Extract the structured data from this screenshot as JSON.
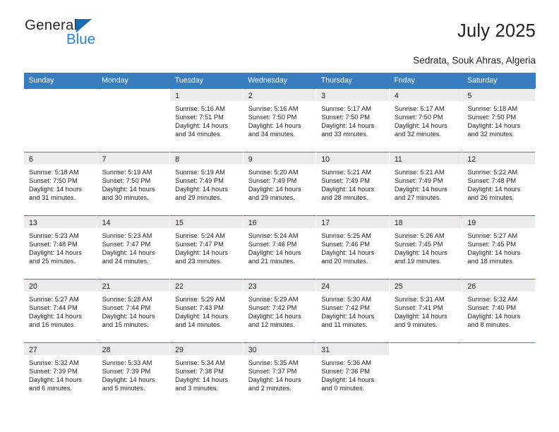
{
  "brand": {
    "name_part1": "General",
    "name_part2": "Blue",
    "accent_color": "#2585d3",
    "triangle_color": "#176cb5"
  },
  "header": {
    "title": "July 2025",
    "subtitle": "Sedrata, Souk Ahras, Algeria"
  },
  "calendar": {
    "header_bg": "#3a7cc0",
    "daynum_bg": "#ebebeb",
    "weekdays": [
      "Sunday",
      "Monday",
      "Tuesday",
      "Wednesday",
      "Thursday",
      "Friday",
      "Saturday"
    ],
    "weeks": [
      [
        {
          "day": "",
          "sunrise": "",
          "sunset": "",
          "daylight_line1": "",
          "daylight_line2": "",
          "empty": true
        },
        {
          "day": "",
          "sunrise": "",
          "sunset": "",
          "daylight_line1": "",
          "daylight_line2": "",
          "empty": true
        },
        {
          "day": "1",
          "sunrise": "Sunrise: 5:16 AM",
          "sunset": "Sunset: 7:51 PM",
          "daylight_line1": "Daylight: 14 hours",
          "daylight_line2": "and 34 minutes.",
          "empty": false
        },
        {
          "day": "2",
          "sunrise": "Sunrise: 5:16 AM",
          "sunset": "Sunset: 7:50 PM",
          "daylight_line1": "Daylight: 14 hours",
          "daylight_line2": "and 34 minutes.",
          "empty": false
        },
        {
          "day": "3",
          "sunrise": "Sunrise: 5:17 AM",
          "sunset": "Sunset: 7:50 PM",
          "daylight_line1": "Daylight: 14 hours",
          "daylight_line2": "and 33 minutes.",
          "empty": false
        },
        {
          "day": "4",
          "sunrise": "Sunrise: 5:17 AM",
          "sunset": "Sunset: 7:50 PM",
          "daylight_line1": "Daylight: 14 hours",
          "daylight_line2": "and 32 minutes.",
          "empty": false
        },
        {
          "day": "5",
          "sunrise": "Sunrise: 5:18 AM",
          "sunset": "Sunset: 7:50 PM",
          "daylight_line1": "Daylight: 14 hours",
          "daylight_line2": "and 32 minutes.",
          "empty": false
        }
      ],
      [
        {
          "day": "6",
          "sunrise": "Sunrise: 5:18 AM",
          "sunset": "Sunset: 7:50 PM",
          "daylight_line1": "Daylight: 14 hours",
          "daylight_line2": "and 31 minutes.",
          "empty": false
        },
        {
          "day": "7",
          "sunrise": "Sunrise: 5:19 AM",
          "sunset": "Sunset: 7:50 PM",
          "daylight_line1": "Daylight: 14 hours",
          "daylight_line2": "and 30 minutes.",
          "empty": false
        },
        {
          "day": "8",
          "sunrise": "Sunrise: 5:19 AM",
          "sunset": "Sunset: 7:49 PM",
          "daylight_line1": "Daylight: 14 hours",
          "daylight_line2": "and 29 minutes.",
          "empty": false
        },
        {
          "day": "9",
          "sunrise": "Sunrise: 5:20 AM",
          "sunset": "Sunset: 7:49 PM",
          "daylight_line1": "Daylight: 14 hours",
          "daylight_line2": "and 29 minutes.",
          "empty": false
        },
        {
          "day": "10",
          "sunrise": "Sunrise: 5:21 AM",
          "sunset": "Sunset: 7:49 PM",
          "daylight_line1": "Daylight: 14 hours",
          "daylight_line2": "and 28 minutes.",
          "empty": false
        },
        {
          "day": "11",
          "sunrise": "Sunrise: 5:21 AM",
          "sunset": "Sunset: 7:49 PM",
          "daylight_line1": "Daylight: 14 hours",
          "daylight_line2": "and 27 minutes.",
          "empty": false
        },
        {
          "day": "12",
          "sunrise": "Sunrise: 5:22 AM",
          "sunset": "Sunset: 7:48 PM",
          "daylight_line1": "Daylight: 14 hours",
          "daylight_line2": "and 26 minutes.",
          "empty": false
        }
      ],
      [
        {
          "day": "13",
          "sunrise": "Sunrise: 5:23 AM",
          "sunset": "Sunset: 7:48 PM",
          "daylight_line1": "Daylight: 14 hours",
          "daylight_line2": "and 25 minutes.",
          "empty": false
        },
        {
          "day": "14",
          "sunrise": "Sunrise: 5:23 AM",
          "sunset": "Sunset: 7:47 PM",
          "daylight_line1": "Daylight: 14 hours",
          "daylight_line2": "and 24 minutes.",
          "empty": false
        },
        {
          "day": "15",
          "sunrise": "Sunrise: 5:24 AM",
          "sunset": "Sunset: 7:47 PM",
          "daylight_line1": "Daylight: 14 hours",
          "daylight_line2": "and 23 minutes.",
          "empty": false
        },
        {
          "day": "16",
          "sunrise": "Sunrise: 5:24 AM",
          "sunset": "Sunset: 7:46 PM",
          "daylight_line1": "Daylight: 14 hours",
          "daylight_line2": "and 21 minutes.",
          "empty": false
        },
        {
          "day": "17",
          "sunrise": "Sunrise: 5:25 AM",
          "sunset": "Sunset: 7:46 PM",
          "daylight_line1": "Daylight: 14 hours",
          "daylight_line2": "and 20 minutes.",
          "empty": false
        },
        {
          "day": "18",
          "sunrise": "Sunrise: 5:26 AM",
          "sunset": "Sunset: 7:45 PM",
          "daylight_line1": "Daylight: 14 hours",
          "daylight_line2": "and 19 minutes.",
          "empty": false
        },
        {
          "day": "19",
          "sunrise": "Sunrise: 5:27 AM",
          "sunset": "Sunset: 7:45 PM",
          "daylight_line1": "Daylight: 14 hours",
          "daylight_line2": "and 18 minutes.",
          "empty": false
        }
      ],
      [
        {
          "day": "20",
          "sunrise": "Sunrise: 5:27 AM",
          "sunset": "Sunset: 7:44 PM",
          "daylight_line1": "Daylight: 14 hours",
          "daylight_line2": "and 16 minutes.",
          "empty": false
        },
        {
          "day": "21",
          "sunrise": "Sunrise: 5:28 AM",
          "sunset": "Sunset: 7:44 PM",
          "daylight_line1": "Daylight: 14 hours",
          "daylight_line2": "and 15 minutes.",
          "empty": false
        },
        {
          "day": "22",
          "sunrise": "Sunrise: 5:29 AM",
          "sunset": "Sunset: 7:43 PM",
          "daylight_line1": "Daylight: 14 hours",
          "daylight_line2": "and 14 minutes.",
          "empty": false
        },
        {
          "day": "23",
          "sunrise": "Sunrise: 5:29 AM",
          "sunset": "Sunset: 7:42 PM",
          "daylight_line1": "Daylight: 14 hours",
          "daylight_line2": "and 12 minutes.",
          "empty": false
        },
        {
          "day": "24",
          "sunrise": "Sunrise: 5:30 AM",
          "sunset": "Sunset: 7:42 PM",
          "daylight_line1": "Daylight: 14 hours",
          "daylight_line2": "and 11 minutes.",
          "empty": false
        },
        {
          "day": "25",
          "sunrise": "Sunrise: 5:31 AM",
          "sunset": "Sunset: 7:41 PM",
          "daylight_line1": "Daylight: 14 hours",
          "daylight_line2": "and 9 minutes.",
          "empty": false
        },
        {
          "day": "26",
          "sunrise": "Sunrise: 5:32 AM",
          "sunset": "Sunset: 7:40 PM",
          "daylight_line1": "Daylight: 14 hours",
          "daylight_line2": "and 8 minutes.",
          "empty": false
        }
      ],
      [
        {
          "day": "27",
          "sunrise": "Sunrise: 5:32 AM",
          "sunset": "Sunset: 7:39 PM",
          "daylight_line1": "Daylight: 14 hours",
          "daylight_line2": "and 6 minutes.",
          "empty": false
        },
        {
          "day": "28",
          "sunrise": "Sunrise: 5:33 AM",
          "sunset": "Sunset: 7:39 PM",
          "daylight_line1": "Daylight: 14 hours",
          "daylight_line2": "and 5 minutes.",
          "empty": false
        },
        {
          "day": "29",
          "sunrise": "Sunrise: 5:34 AM",
          "sunset": "Sunset: 7:38 PM",
          "daylight_line1": "Daylight: 14 hours",
          "daylight_line2": "and 3 minutes.",
          "empty": false
        },
        {
          "day": "30",
          "sunrise": "Sunrise: 5:35 AM",
          "sunset": "Sunset: 7:37 PM",
          "daylight_line1": "Daylight: 14 hours",
          "daylight_line2": "and 2 minutes.",
          "empty": false
        },
        {
          "day": "31",
          "sunrise": "Sunrise: 5:36 AM",
          "sunset": "Sunset: 7:36 PM",
          "daylight_line1": "Daylight: 14 hours",
          "daylight_line2": "and 0 minutes.",
          "empty": false
        },
        {
          "day": "",
          "sunrise": "",
          "sunset": "",
          "daylight_line1": "",
          "daylight_line2": "",
          "empty": true
        },
        {
          "day": "",
          "sunrise": "",
          "sunset": "",
          "daylight_line1": "",
          "daylight_line2": "",
          "empty": true
        }
      ]
    ]
  }
}
